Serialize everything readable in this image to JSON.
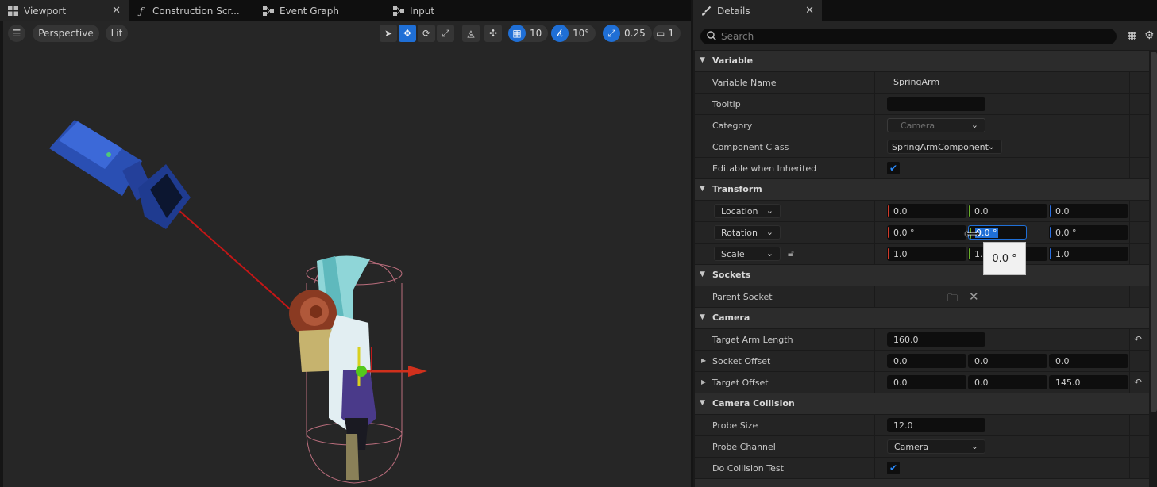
{
  "tabs_left": [
    {
      "label": "Viewport",
      "icon": "grid-icon",
      "active": true,
      "closable": true
    },
    {
      "label": "Construction Scr...",
      "icon": "function-icon",
      "active": false
    },
    {
      "label": "Event Graph",
      "icon": "graph-icon",
      "active": false
    },
    {
      "label": "Input",
      "icon": "graph-icon",
      "active": false
    }
  ],
  "tab_details": {
    "label": "Details",
    "icon": "brush-icon"
  },
  "viewport_toolbar": {
    "perspective": "Perspective",
    "lit": "Lit",
    "grid_snap": "10",
    "rotation_snap": "10°",
    "scale_snap": "0.25",
    "camera_speed": "1"
  },
  "details": {
    "search_placeholder": "Search",
    "categories": {
      "variable": "Variable",
      "transform": "Transform",
      "sockets": "Sockets",
      "camera": "Camera",
      "camera_collision": "Camera Collision"
    },
    "variable": {
      "name_label": "Variable Name",
      "name_value": "SpringArm",
      "tooltip_label": "Tooltip",
      "tooltip_value": "",
      "category_label": "Category",
      "category_value": "Camera",
      "class_label": "Component Class",
      "class_value": "SpringArmComponent",
      "editable_label": "Editable when Inherited",
      "editable_checked": true
    },
    "transform": {
      "location_label": "Location",
      "location": [
        "0.0",
        "0.0",
        "0.0"
      ],
      "rotation_label": "Rotation",
      "rotation": [
        "0.0 °",
        "0.0 °",
        "0.0 °"
      ],
      "scale_label": "Scale",
      "scale": [
        "1.0",
        "1.",
        "1.0"
      ]
    },
    "sockets": {
      "parent_label": "Parent Socket"
    },
    "camera": {
      "arm_length_label": "Target Arm Length",
      "arm_length": "160.0",
      "socket_offset_label": "Socket Offset",
      "socket_offset": [
        "0.0",
        "0.0",
        "0.0"
      ],
      "target_offset_label": "Target Offset",
      "target_offset": [
        "0.0",
        "0.0",
        "145.0"
      ]
    },
    "collision": {
      "probe_size_label": "Probe Size",
      "probe_size": "12.0",
      "probe_channel_label": "Probe Channel",
      "probe_channel": "Camera",
      "do_test_label": "Do Collision Test",
      "do_test_checked": true
    }
  },
  "tooltip_value": "0.0 °",
  "colors": {
    "accent": "#1f6fd6",
    "axis_x": "#d03a2a",
    "axis_y": "#6ab02a",
    "axis_z": "#2b6fe0"
  }
}
